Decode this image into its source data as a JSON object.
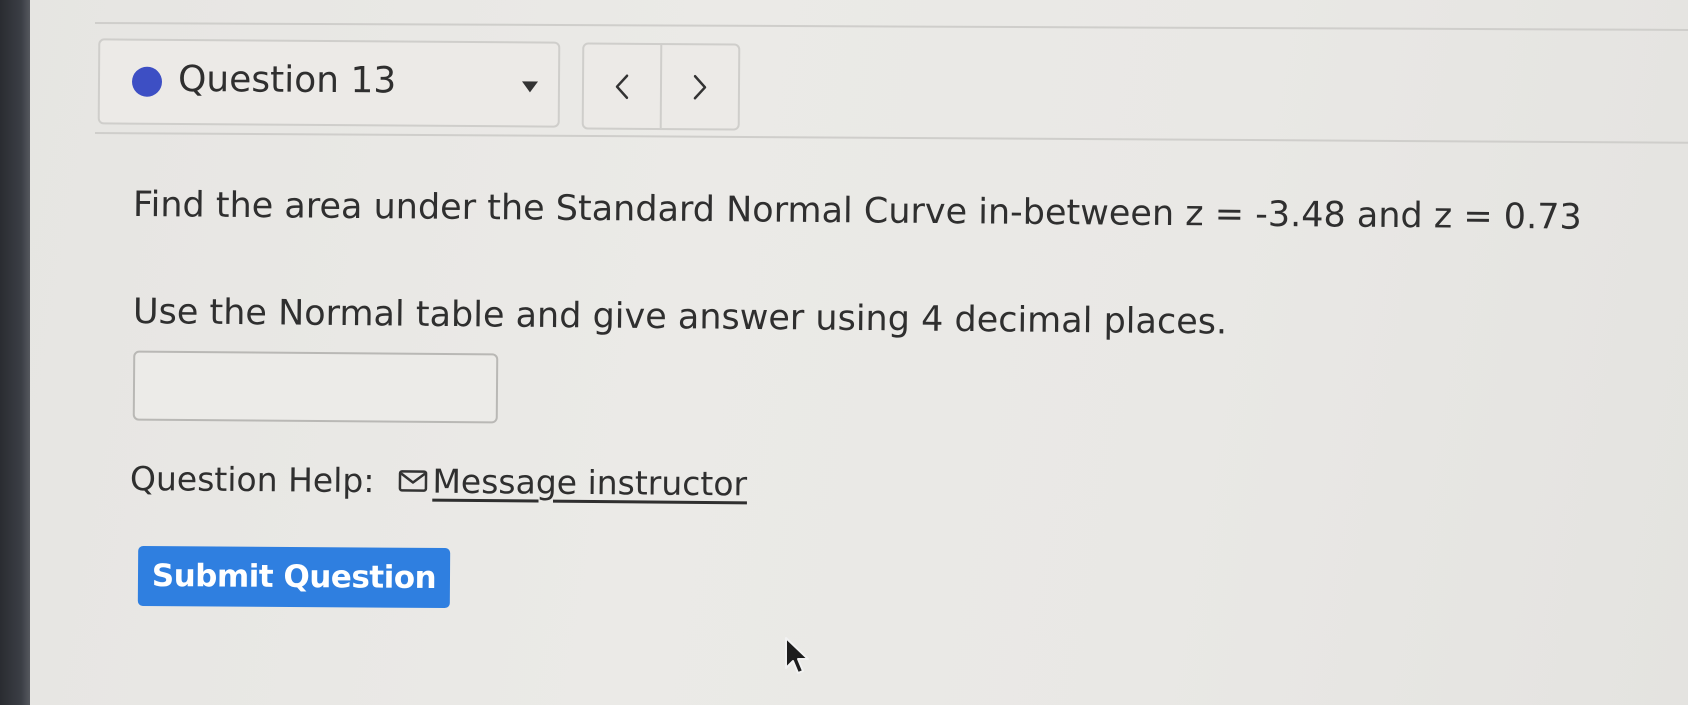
{
  "header": {
    "question_label": "Question 13",
    "prev_glyph": "<",
    "next_glyph": ">"
  },
  "question": {
    "prompt_line1": "Find the area under the Standard Normal Curve in-between z = -3.48 and z = 0.73",
    "prompt_line2": "Use the Normal table and give answer using 4 decimal places.",
    "answer_value": "",
    "answer_placeholder": ""
  },
  "help": {
    "label": "Question Help:",
    "message_link": "Message instructor",
    "icon": "mail-icon"
  },
  "actions": {
    "submit_label": "Submit Question"
  },
  "colors": {
    "status_dot": "#3d4fc4",
    "submit_button": "#2f7fe0"
  }
}
